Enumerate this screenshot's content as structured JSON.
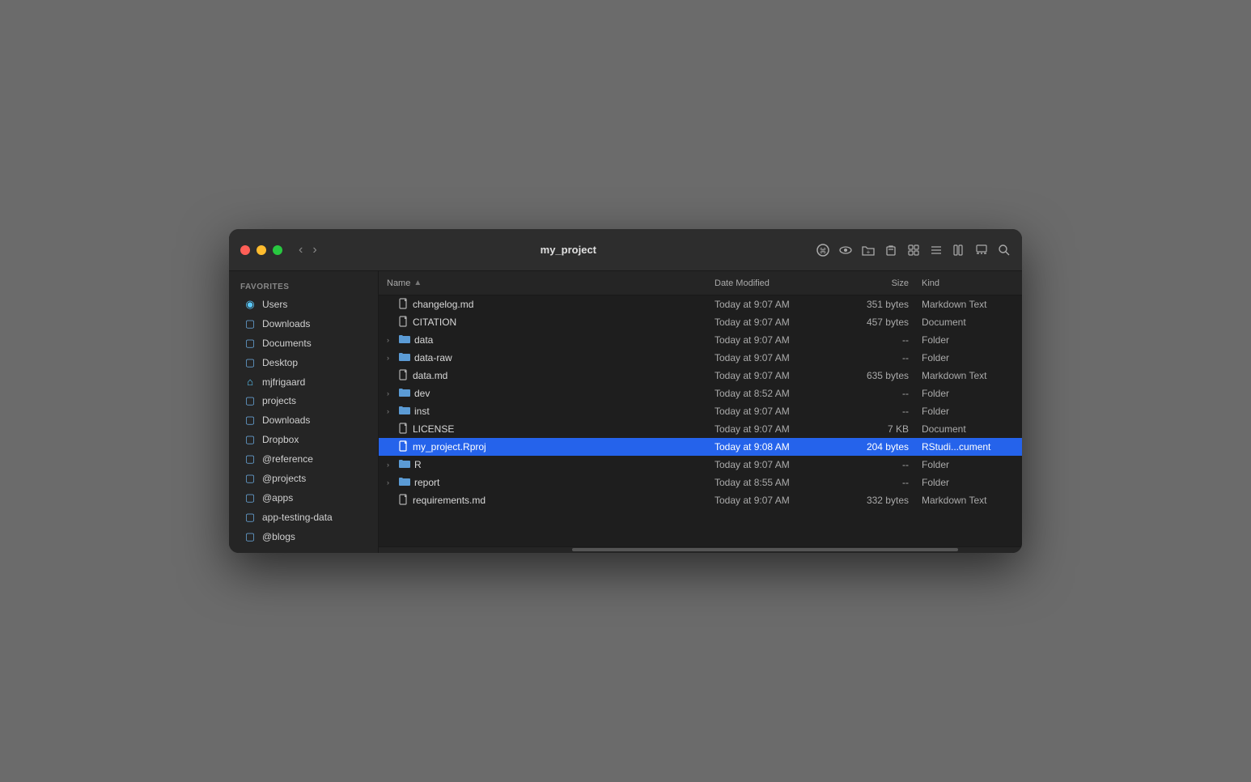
{
  "window": {
    "title": "my_project",
    "traffic_lights": {
      "close_label": "close",
      "minimize_label": "minimize",
      "maximize_label": "maximize"
    }
  },
  "sidebar": {
    "section_label": "Favorites",
    "items": [
      {
        "id": "users",
        "label": "Users",
        "icon_type": "person"
      },
      {
        "id": "downloads1",
        "label": "Downloads",
        "icon_type": "folder"
      },
      {
        "id": "documents",
        "label": "Documents",
        "icon_type": "folder"
      },
      {
        "id": "desktop",
        "label": "Desktop",
        "icon_type": "folder"
      },
      {
        "id": "mjfrigaard",
        "label": "mjfrigaard",
        "icon_type": "home"
      },
      {
        "id": "projects",
        "label": "projects",
        "icon_type": "folder"
      },
      {
        "id": "downloads2",
        "label": "Downloads",
        "icon_type": "folder"
      },
      {
        "id": "dropbox",
        "label": "Dropbox",
        "icon_type": "folder"
      },
      {
        "id": "reference",
        "label": "@reference",
        "icon_type": "folder"
      },
      {
        "id": "atprojects",
        "label": "@projects",
        "icon_type": "folder"
      },
      {
        "id": "apps",
        "label": "@apps",
        "icon_type": "folder"
      },
      {
        "id": "apptesting",
        "label": "app-testing-data",
        "icon_type": "folder"
      },
      {
        "id": "blogs",
        "label": "@blogs",
        "icon_type": "folder"
      }
    ]
  },
  "columns": {
    "name": "Name",
    "modified": "Date Modified",
    "size": "Size",
    "kind": "Kind"
  },
  "files": [
    {
      "id": "changelog",
      "name": "changelog.md",
      "type": "file",
      "modified": "Today at 9:07 AM",
      "size": "351 bytes",
      "kind": "Markdown Text",
      "expandable": false,
      "selected": false
    },
    {
      "id": "citation",
      "name": "CITATION",
      "type": "file",
      "modified": "Today at 9:07 AM",
      "size": "457 bytes",
      "kind": "Document",
      "expandable": false,
      "selected": false
    },
    {
      "id": "data",
      "name": "data",
      "type": "folder",
      "modified": "Today at 9:07 AM",
      "size": "--",
      "kind": "Folder",
      "expandable": true,
      "selected": false
    },
    {
      "id": "dataraw",
      "name": "data-raw",
      "type": "folder",
      "modified": "Today at 9:07 AM",
      "size": "--",
      "kind": "Folder",
      "expandable": true,
      "selected": false
    },
    {
      "id": "datamd",
      "name": "data.md",
      "type": "file",
      "modified": "Today at 9:07 AM",
      "size": "635 bytes",
      "kind": "Markdown Text",
      "expandable": false,
      "selected": false
    },
    {
      "id": "dev",
      "name": "dev",
      "type": "folder",
      "modified": "Today at 8:52 AM",
      "size": "--",
      "kind": "Folder",
      "expandable": true,
      "selected": false
    },
    {
      "id": "inst",
      "name": "inst",
      "type": "folder",
      "modified": "Today at 9:07 AM",
      "size": "--",
      "kind": "Folder",
      "expandable": true,
      "selected": false
    },
    {
      "id": "license",
      "name": "LICENSE",
      "type": "file",
      "modified": "Today at 9:07 AM",
      "size": "7 KB",
      "kind": "Document",
      "expandable": false,
      "selected": false
    },
    {
      "id": "myproject",
      "name": "my_project.Rproj",
      "type": "file",
      "modified": "Today at 9:08 AM",
      "size": "204 bytes",
      "kind": "RStudi...cument",
      "expandable": false,
      "selected": true
    },
    {
      "id": "r",
      "name": "R",
      "type": "folder",
      "modified": "Today at 9:07 AM",
      "size": "--",
      "kind": "Folder",
      "expandable": true,
      "selected": false
    },
    {
      "id": "report",
      "name": "report",
      "type": "folder",
      "modified": "Today at 8:55 AM",
      "size": "--",
      "kind": "Folder",
      "expandable": true,
      "selected": false
    },
    {
      "id": "requirements",
      "name": "requirements.md",
      "type": "file",
      "modified": "Today at 9:07 AM",
      "size": "332 bytes",
      "kind": "Markdown Text",
      "expandable": false,
      "selected": false
    }
  ]
}
